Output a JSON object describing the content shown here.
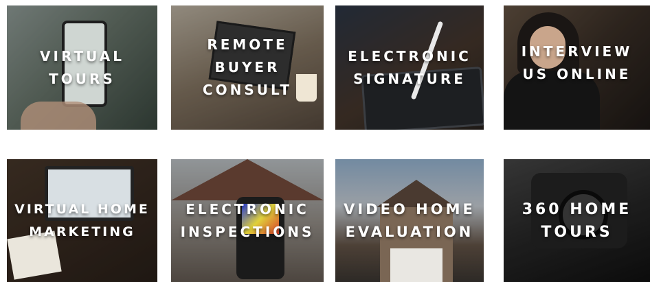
{
  "tiles": [
    {
      "lines": [
        "VIRTUAL",
        "TOURS"
      ]
    },
    {
      "lines": [
        "REMOTE",
        "BUYER",
        "CONSULT"
      ]
    },
    {
      "lines": [
        "ELECTRONIC",
        "SIGNATURE"
      ]
    },
    {
      "lines": [
        "INTERVIEW",
        "US ONLINE"
      ]
    },
    {
      "lines": [
        "VIRTUAL HOME",
        "MARKETING"
      ]
    },
    {
      "lines": [
        "ELECTRONIC",
        "INSPECTIONS"
      ]
    },
    {
      "lines": [
        "VIDEO HOME",
        "EVALUATION"
      ]
    },
    {
      "lines": [
        "360 HOME",
        "TOURS"
      ]
    }
  ]
}
